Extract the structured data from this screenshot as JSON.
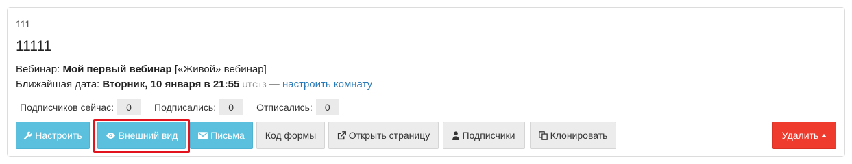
{
  "card": {
    "small_title": "111",
    "title": "11111",
    "webinar_label": "Вебинар: ",
    "webinar_name": "Мой первый вебинар",
    "webinar_type": " [«Живой» вебинар]",
    "date_label": "Ближайшая дата: ",
    "date_value": "Вторник, 10 января в 21:55",
    "timezone": "UTC+3",
    "date_separator": " — ",
    "setup_room_link": "настроить комнату"
  },
  "stats": [
    {
      "label": "Подписчиков сейчас:",
      "value": "0"
    },
    {
      "label": "Подписались:",
      "value": "0"
    },
    {
      "label": "Отписались:",
      "value": "0"
    }
  ],
  "buttons": {
    "configure": "Настроить",
    "appearance": "Внешний вид",
    "letters": "Письма",
    "form_code": "Код формы",
    "open_page": "Открыть страницу",
    "subscribers": "Подписчики",
    "clone": "Клонировать",
    "delete": "Удалить"
  },
  "icons": {
    "configure": "wrench-icon",
    "appearance": "eye-icon",
    "letters": "envelope-icon",
    "open_page": "external-link-icon",
    "subscribers": "user-icon",
    "clone": "copy-icon",
    "delete": "caret-up-icon"
  },
  "colors": {
    "info_button": "#5bc0de",
    "default_button": "#ececec",
    "danger_button": "#ef3b2d",
    "link": "#2a7ab7",
    "highlight_frame": "#e3131e"
  }
}
